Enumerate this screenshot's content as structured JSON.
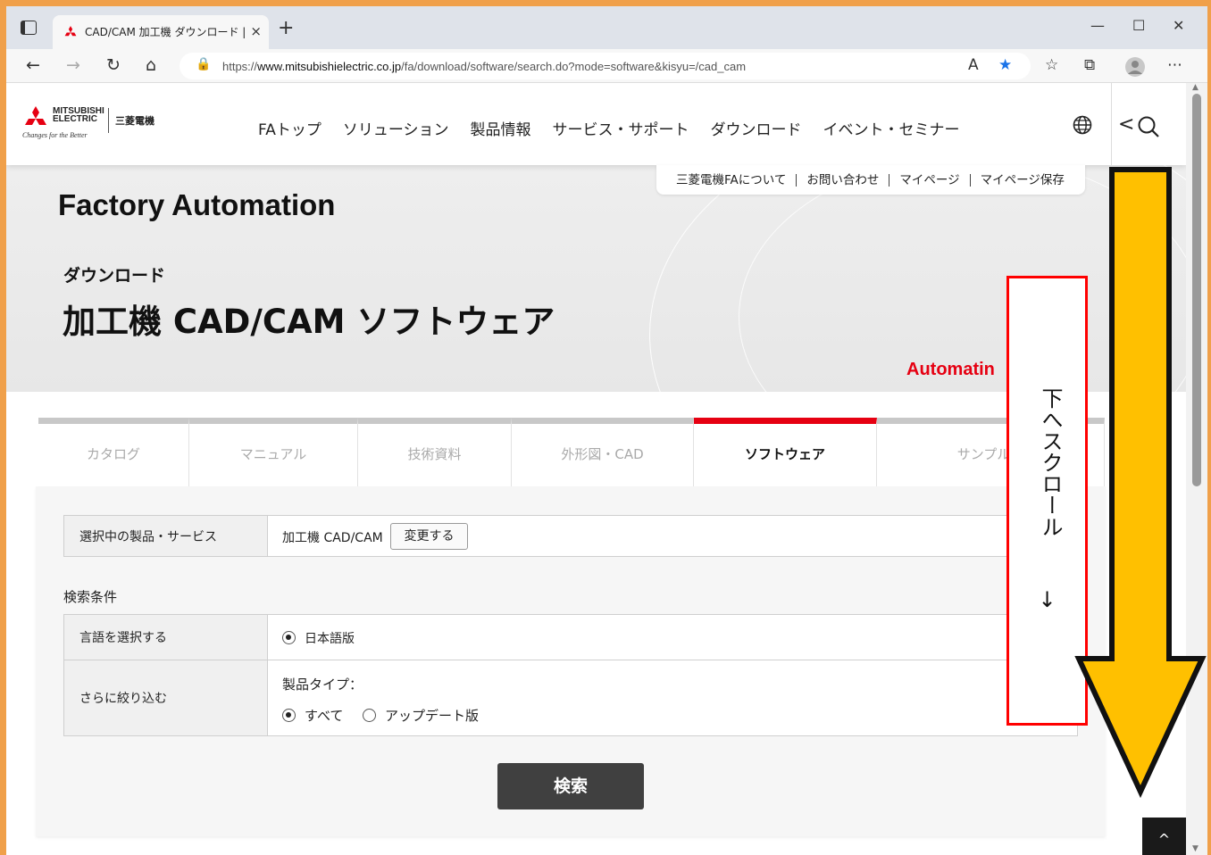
{
  "browser": {
    "tab_title": "CAD/CAM 加工機 ダウンロード | 三",
    "tab_close": "×",
    "new_tab": "+",
    "window_controls": {
      "minimize": "—",
      "maximize": "☐",
      "close": "✕"
    },
    "nav": {
      "back": "←",
      "forward": "→",
      "reload": "↻",
      "home": "⌂"
    },
    "url_prefix": "https://",
    "url_domain": "www.mitsubishielectric.co.jp",
    "url_path": "/fa/download/software/search.do?mode=software&kisyu=/cad_cam",
    "lock_icon": "🔒",
    "read_aloud": "A",
    "favorite": "★",
    "favorites_list": "☆",
    "collections": "⧉",
    "more": "⋯"
  },
  "site": {
    "logo_word1": "MITSUBISHI",
    "logo_word2": "ELECTRIC",
    "logo_tagline": "Changes for the Better",
    "logo_jp": "三菱電機",
    "global_nav": [
      "FAトップ",
      "ソリューション",
      "製品情報",
      "サービス・サポート",
      "ダウンロード",
      "イベント・セミナー"
    ],
    "back_chevron": "<",
    "utility_links": [
      "三菱電機FAについて",
      "お問い合わせ",
      "マイページ",
      "マイページ保存"
    ]
  },
  "hero": {
    "fa_title": "Factory Automation",
    "section_label": "ダウンロード",
    "page_title": "加工機 CAD/CAM ソフトウェア",
    "tagline_partial": "Automatin"
  },
  "category_tabs": [
    {
      "label": "カタログ",
      "active": false
    },
    {
      "label": "マニュアル",
      "active": false
    },
    {
      "label": "技術資料",
      "active": false
    },
    {
      "label": "外形図・CAD",
      "active": false
    },
    {
      "label": "ソフトウェア",
      "active": true
    },
    {
      "label": "サンプルラ",
      "active": false
    }
  ],
  "form": {
    "selected_label": "選択中の製品・サービス",
    "selected_value": "加工機 CAD/CAM",
    "change_button": "変更する",
    "conditions_heading": "検索条件",
    "language_label": "言語を選択する",
    "language_option": "日本語版",
    "narrow_label": "さらに絞り込む",
    "product_type_label": "製品タイプ：",
    "type_options": [
      {
        "label": "すべて",
        "selected": true
      },
      {
        "label": "アップデート版",
        "selected": false
      }
    ],
    "search_button": "検索"
  },
  "to_top": "^",
  "annotation": {
    "note_text": "下へスクロール",
    "note_arrow": "↓",
    "border_color": "#ff0000",
    "arrow_color": "#ffc000"
  },
  "colors": {
    "brand_red": "#e60012",
    "frame_orange": "#f0a04a",
    "button_dark": "#404040"
  }
}
